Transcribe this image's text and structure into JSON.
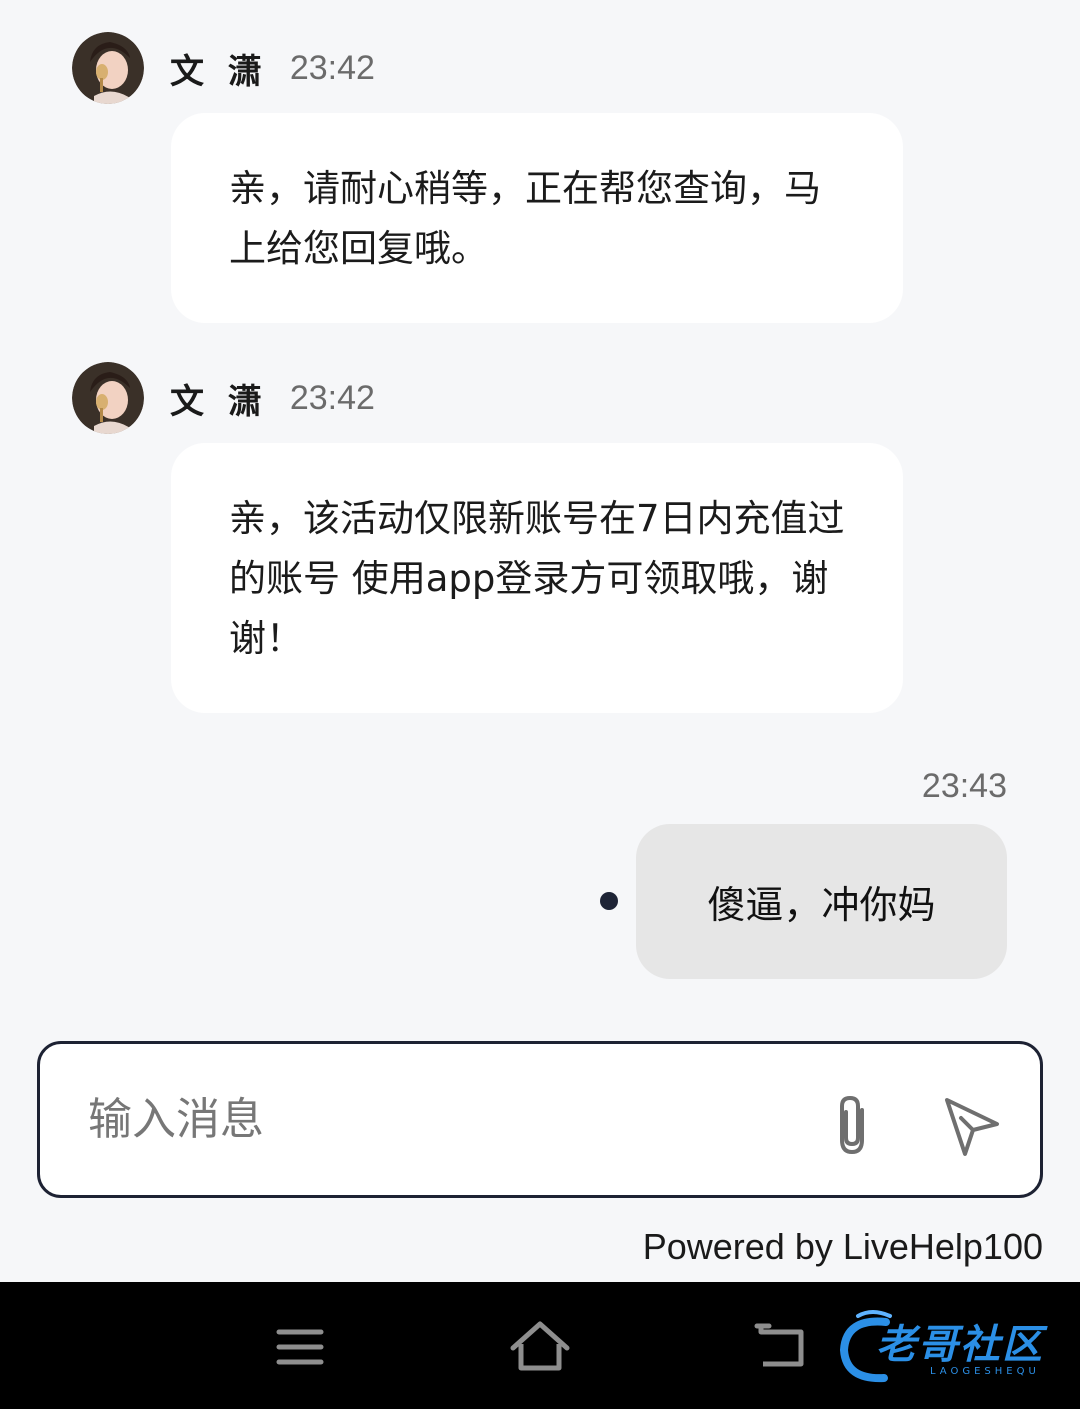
{
  "messages": [
    {
      "sender": "文 潇",
      "time": "23:42",
      "text": "亲，请耐心稍等，正在帮您查询，马上给您回复哦。"
    },
    {
      "sender": "文 潇",
      "time": "23:42",
      "text": "亲，该活动仅限新账号在7日内充值过的账号 使用app登录方可领取哦，谢谢！"
    }
  ],
  "outgoing": {
    "time": "23:43",
    "text": "傻逼，冲你妈"
  },
  "composer": {
    "placeholder": "输入消息",
    "value": ""
  },
  "footer": {
    "powered_by": "Powered by LiveHelp100"
  },
  "watermark": {
    "text": "老哥社区",
    "sub": "LAOGESHEQU"
  },
  "icons": {
    "attach": "paperclip-icon",
    "send": "send-icon",
    "nav_menu": "menu-icon",
    "nav_home": "home-icon",
    "nav_back": "back-icon"
  },
  "colors": {
    "background": "#f6f7f9",
    "agent_bubble": "#ffffff",
    "user_bubble": "#e6e6e6",
    "input_border": "#1d2233",
    "nav_bar": "#000000"
  }
}
